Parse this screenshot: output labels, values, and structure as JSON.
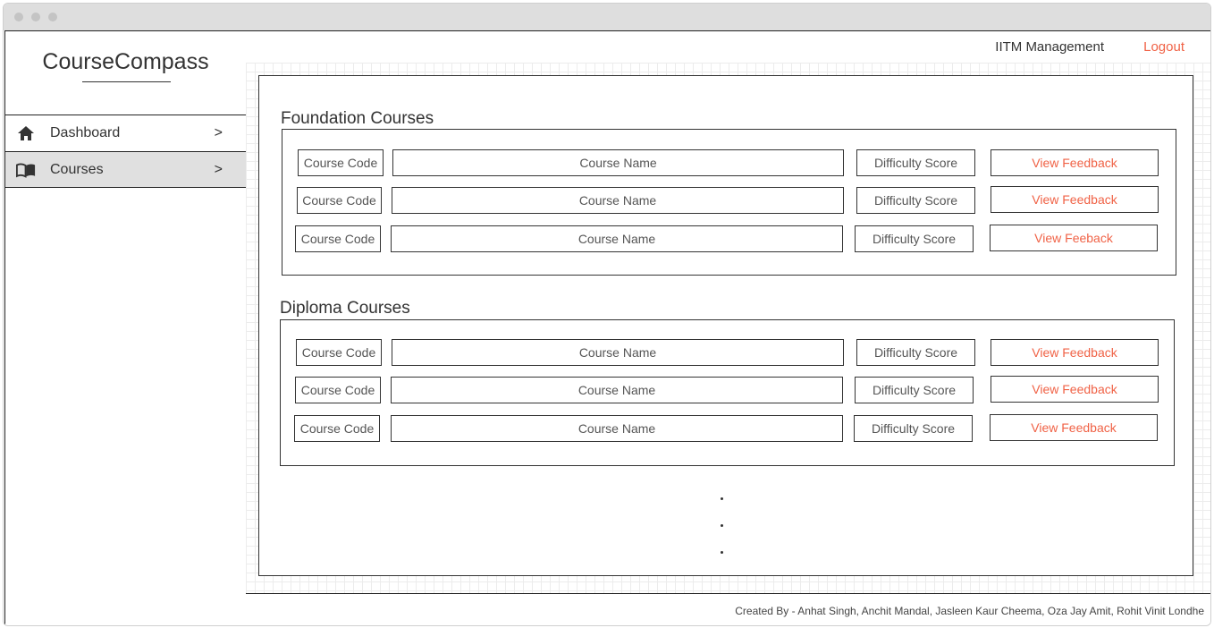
{
  "app": {
    "brand": "CourseCompass"
  },
  "sidebar": {
    "items": [
      {
        "label": "Dashboard",
        "icon": "home-icon",
        "chevron": ">"
      },
      {
        "label": "Courses",
        "icon": "book-icon",
        "chevron": ">"
      }
    ]
  },
  "header": {
    "org": "IITM Management",
    "logout": "Logout"
  },
  "sections": [
    {
      "title": "Foundation Courses",
      "rows": [
        {
          "code": "Course Code",
          "name": "Course Name",
          "difficulty": "Difficulty Score",
          "feedback": "View Feedback"
        },
        {
          "code": "Course Code",
          "name": "Course Name",
          "difficulty": "Difficulty Score",
          "feedback": "View Feedback"
        },
        {
          "code": "Course Code",
          "name": "Course Name",
          "difficulty": "Difficulty Score",
          "feedback": "View Feeback"
        }
      ]
    },
    {
      "title": "Diploma Courses",
      "rows": [
        {
          "code": "Course Code",
          "name": "Course Name",
          "difficulty": "Difficulty Score",
          "feedback": "View Feedback"
        },
        {
          "code": "Course Code",
          "name": "Course Name",
          "difficulty": "Difficulty Score",
          "feedback": "View Feedback"
        },
        {
          "code": "Course Code",
          "name": "Course Name",
          "difficulty": "Difficulty Score",
          "feedback": "View Feedback"
        }
      ]
    }
  ],
  "more_indicator": ".",
  "footer": {
    "credits": "Created By - Anhat Singh, Anchit Mandal, Jasleen Kaur Cheema, Oza Jay Amit, Rohit Vinit Londhe"
  },
  "colors": {
    "accent": "#f06246",
    "border": "#333333",
    "active_nav_bg": "#e0e0e0"
  }
}
